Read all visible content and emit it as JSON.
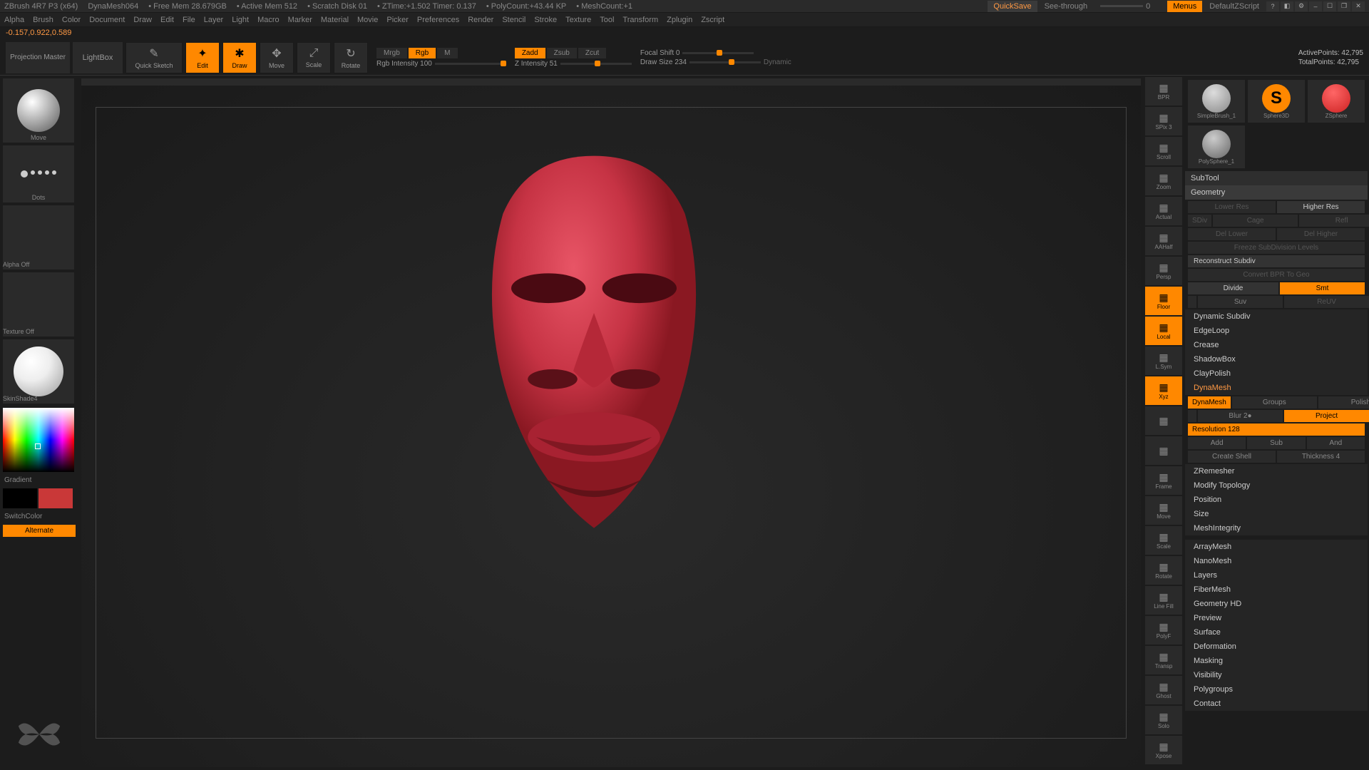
{
  "title_bar": {
    "app": "ZBrush 4R7 P3 (x64)",
    "project": "DynaMesh064",
    "free_mem": "• Free Mem 28.679GB",
    "active_mem": "• Active Mem 512",
    "scratch": "• Scratch Disk 01",
    "ztime": "• ZTime:+1.502 Timer: 0.137",
    "polycount": "• PolyCount:+43.44 KP",
    "meshcount": "• MeshCount:+1",
    "quicksave": "QuickSave",
    "seethrough": "See-through",
    "seethrough_val": "0",
    "menus": "Menus",
    "default_script": "DefaultZScript"
  },
  "menu": [
    "Alpha",
    "Brush",
    "Color",
    "Document",
    "Draw",
    "Edit",
    "File",
    "Layer",
    "Light",
    "Macro",
    "Marker",
    "Material",
    "Movie",
    "Picker",
    "Preferences",
    "Render",
    "Stencil",
    "Stroke",
    "Texture",
    "Tool",
    "Transform",
    "Zplugin",
    "Zscript"
  ],
  "coords": "-0.157,0.922,0.589",
  "toolbar": {
    "projection_master": "Projection Master",
    "lightbox": "LightBox",
    "quick_sketch": "Quick Sketch",
    "edit": "Edit",
    "draw": "Draw",
    "move": "Move",
    "scale": "Scale",
    "rotate": "Rotate",
    "mrgb": "Mrgb",
    "rgb": "Rgb",
    "m": "M",
    "rgb_intensity": "Rgb Intensity 100",
    "zadd": "Zadd",
    "zsub": "Zsub",
    "zcut": "Zcut",
    "z_intensity": "Z Intensity 51",
    "focal_shift": "Focal Shift 0",
    "draw_size": "Draw Size 234",
    "dynamic": "Dynamic",
    "active_points": "ActivePoints: 42,795",
    "total_points": "TotalPoints: 42,795"
  },
  "left_panel": {
    "brush_label": "Move",
    "stroke_label": "Dots",
    "alpha_label": "Alpha Off",
    "texture_label": "Texture Off",
    "material_label": "SkinShade4",
    "gradient": "Gradient",
    "switch_color": "SwitchColor",
    "alternate": "Alternate"
  },
  "right_tools": [
    "BPR",
    "SPix 3",
    "Scroll",
    "Zoom",
    "Actual",
    "AAHalf",
    "Persp",
    "Floor",
    "Local",
    "L.Sym",
    "Xyz",
    "",
    "",
    "Frame",
    "Move",
    "Scale",
    "Rotate",
    "Line Fill",
    "PolyF",
    "Transp",
    "Ghost",
    "Solo",
    "Xpose"
  ],
  "right_tools_active": [
    false,
    false,
    false,
    false,
    false,
    false,
    false,
    true,
    true,
    false,
    true,
    false,
    false,
    false,
    false,
    false,
    false,
    false,
    false,
    false,
    false,
    false,
    false
  ],
  "tool_thumbs": [
    "SimpleBrush_1",
    "Sphere3D",
    "ZSphere",
    "PolySphere_1"
  ],
  "panels": {
    "subtool": "SubTool",
    "geometry": "Geometry",
    "lower_res": "Lower Res",
    "higher_res": "Higher Res",
    "sdiv": "SDiv",
    "cage": "Cage",
    "refl": "Refl",
    "del_lower": "Del Lower",
    "del_higher": "Del Higher",
    "freeze": "Freeze SubDivision Levels",
    "reconstruct": "Reconstruct Subdiv",
    "convert": "Convert BPR To Geo",
    "divide": "Divide",
    "smt": "Smt",
    "suv": "Suv",
    "rstr": "ReUV",
    "dynamic_subdiv": "Dynamic Subdiv",
    "edgeloop": "EdgeLoop",
    "crease": "Crease",
    "shadowbox": "ShadowBox",
    "claypolish": "ClayPolish",
    "dynamesh": "DynaMesh",
    "dynamesh_btn": "DynaMesh",
    "groups": "Groups",
    "polish": "Polish",
    "blur": "Blur 2●",
    "project": "Project",
    "resolution": "Resolution 128",
    "add": "Add",
    "sub": "Sub",
    "and": "And",
    "create_shell": "Create Shell",
    "thickness": "Thickness 4",
    "zremesher": "ZRemesher",
    "modify_topology": "Modify Topology",
    "position": "Position",
    "size": "Size",
    "meshintegrity": "MeshIntegrity",
    "arraymesh": "ArrayMesh",
    "nanomesh": "NanoMesh",
    "layers": "Layers",
    "fibermesh": "FiberMesh",
    "geometry_hd": "Geometry HD",
    "preview": "Preview",
    "surface": "Surface",
    "deformation": "Deformation",
    "masking": "Masking",
    "visibility": "Visibility",
    "polygroups": "Polygroups",
    "contact": "Contact"
  }
}
